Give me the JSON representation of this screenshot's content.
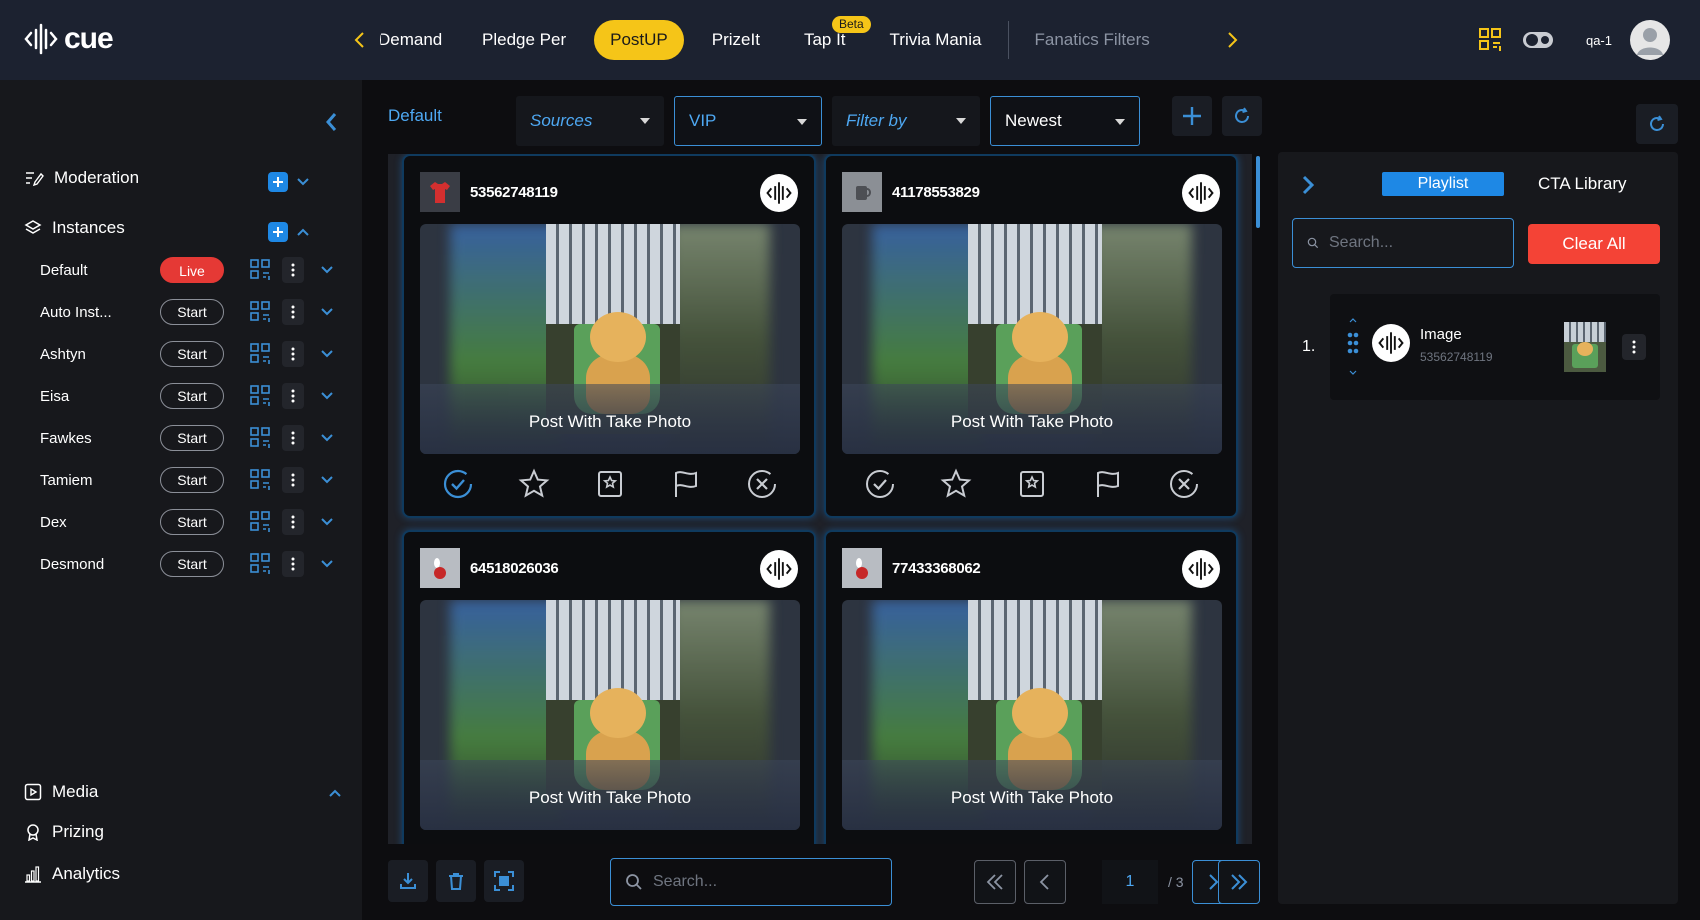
{
  "app": {
    "logo_text": "cue",
    "user": "qa-1"
  },
  "top_nav": {
    "tabs": [
      {
        "label": "Demand",
        "state": "clipped"
      },
      {
        "label": "Pledge Per",
        "state": "normal"
      },
      {
        "label": "PostUP",
        "state": "active"
      },
      {
        "label": "PrizeIt",
        "state": "normal"
      },
      {
        "label": "Tap It",
        "state": "normal",
        "badge": "Beta"
      },
      {
        "label": "Trivia Mania",
        "state": "normal"
      },
      {
        "label": "Fanatics Filters",
        "state": "dim"
      }
    ],
    "icons": [
      "chevron-left-icon",
      "chevron-right-icon",
      "qr-code-icon",
      "theme-toggle-icon",
      "avatar-icon"
    ]
  },
  "sidebar": {
    "moderation_label": "Moderation",
    "instances_label": "Instances",
    "instances": [
      {
        "name": "Default",
        "status": "Live"
      },
      {
        "name": "Auto Inst...",
        "status": "Start"
      },
      {
        "name": "Ashtyn",
        "status": "Start"
      },
      {
        "name": "Eisa",
        "status": "Start"
      },
      {
        "name": "Fawkes",
        "status": "Start"
      },
      {
        "name": "Tamiem",
        "status": "Start"
      },
      {
        "name": "Dex",
        "status": "Start"
      },
      {
        "name": "Desmond",
        "status": "Start"
      }
    ],
    "media_label": "Media",
    "prizing_label": "Prizing",
    "analytics_label": "Analytics"
  },
  "main": {
    "breadcrumb": "Default",
    "filters": {
      "sources": "Sources",
      "vip": "VIP",
      "filter_by": "Filter by",
      "sort": "Newest"
    },
    "cards": [
      {
        "id": "53562748119",
        "caption": "Post With Take Photo",
        "avatar": "red-shirt",
        "approved": true
      },
      {
        "id": "41178553829",
        "caption": "Post With Take Photo",
        "avatar": "mug",
        "approved": false
      },
      {
        "id": "64518026036",
        "caption": "Post With Take Photo",
        "avatar": "bowling",
        "approved": false
      },
      {
        "id": "77433368062",
        "caption": "Post With Take Photo",
        "avatar": "bowling",
        "approved": false
      }
    ],
    "bottom": {
      "search_placeholder": "Search...",
      "current_page": "1",
      "total_pages": "/ 3"
    }
  },
  "right_panel": {
    "tab_playlist": "Playlist",
    "tab_cta": "CTA Library",
    "search_placeholder": "Search...",
    "clear_all": "Clear All",
    "playlist": [
      {
        "index": "1.",
        "title": "Image",
        "subtitle": "53562748119"
      }
    ]
  },
  "colors": {
    "accent_blue": "#1e88e5",
    "active_tab_yellow": "#f5c518",
    "live_red": "#e53935",
    "clear_red": "#f44336",
    "topbar_bg": "#1c2230"
  }
}
